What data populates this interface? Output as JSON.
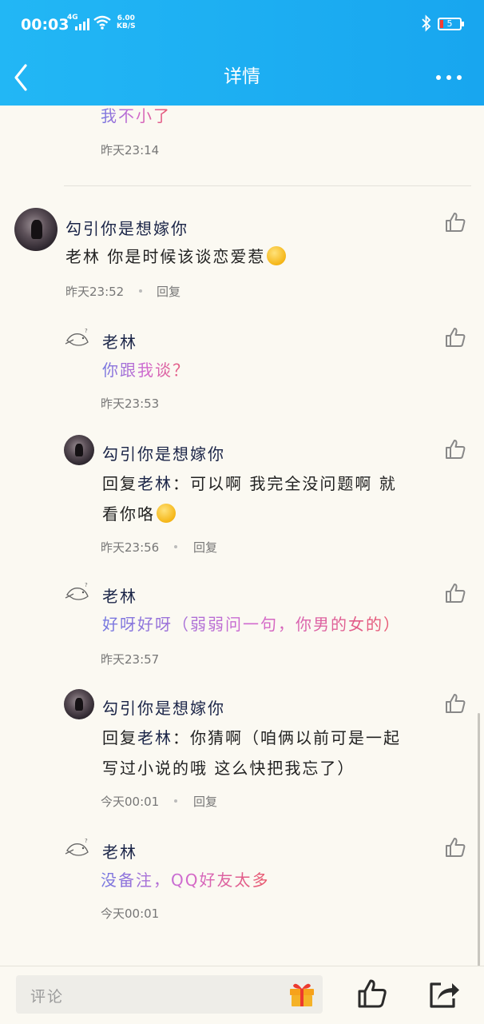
{
  "status_bar": {
    "time": "00:03",
    "network": "4G",
    "speed_value": "6.00",
    "speed_unit": "KB/S",
    "battery": "5"
  },
  "header": {
    "title": "详情"
  },
  "colors": {
    "header_bg": "#1aa9f0",
    "background": "#fbf9f2",
    "name_color": "#1a2447",
    "gradient_text": [
      "#7478e0",
      "#d26ad0",
      "#e9576a"
    ]
  },
  "comments": [
    {
      "text": "我不小了",
      "time": "昨天23:14",
      "style": "gradient"
    },
    {
      "name": "勾引你是想嫁你",
      "text": "老林 你是时候该谈恋爱惹",
      "time": "昨天23:52",
      "reply": "回复",
      "emoji": "yawning-face"
    },
    {
      "name": "老林",
      "text": "你跟我谈？",
      "time": "昨天23:53",
      "style": "gradient"
    },
    {
      "name": "勾引你是想嫁你",
      "reply_prefix": "回复",
      "reply_to": "老林",
      "text_line1": "：可以啊 我完全没问题啊 就",
      "text_line2": "看你咯",
      "time": "昨天23:56",
      "reply": "回复",
      "emoji": "grinning-face"
    },
    {
      "name": "老林",
      "text": "好呀好呀（弱弱问一句，你男的女的）",
      "time": "昨天23:57",
      "style": "gradient"
    },
    {
      "name": "勾引你是想嫁你",
      "reply_prefix": "回复",
      "reply_to": "老林",
      "text_line1": "：你猜啊（咱俩以前可是一起",
      "text_line2": "写过小说的哦 这么快把我忘了）",
      "time": "今天00:01",
      "reply": "回复"
    },
    {
      "name": "老林",
      "text": "没备注，QQ好友太多",
      "time": "今天00:01",
      "style": "gradient"
    }
  ],
  "bottom_bar": {
    "comment_placeholder": "评论"
  },
  "icons": [
    "back-arrow-icon",
    "more-dots-icon",
    "thumbs-up-icon",
    "gift-icon",
    "share-icon",
    "bluetooth-icon",
    "wifi-icon",
    "battery-icon"
  ]
}
